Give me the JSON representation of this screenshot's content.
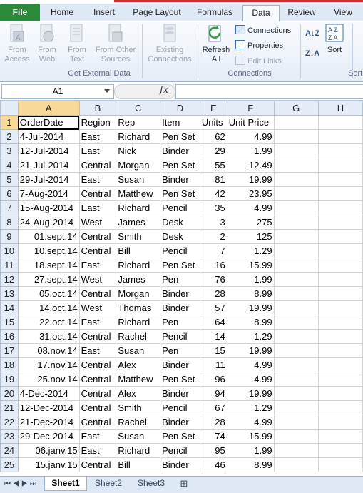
{
  "ribbon_tabs": [
    "File",
    "Home",
    "Insert",
    "Page Layout",
    "Formulas",
    "Data",
    "Review",
    "View"
  ],
  "active_tab": "Data",
  "ribbon": {
    "get_external": {
      "from_access": "From\nAccess",
      "from_web": "From\nWeb",
      "from_text": "From\nText",
      "from_other": "From Other\nSources",
      "existing": "Existing\nConnections",
      "group_label": "Get External Data"
    },
    "connections": {
      "refresh_all": "Refresh\nAll",
      "connections": "Connections",
      "properties": "Properties",
      "edit_links": "Edit Links",
      "group_label": "Connections"
    },
    "sort": {
      "sort_label": "Sort",
      "group_label": "Sort"
    }
  },
  "formula_bar": {
    "name_box": "A1",
    "fx": "fx",
    "value": ""
  },
  "columns": [
    "A",
    "B",
    "C",
    "D",
    "E",
    "F",
    "G",
    "H"
  ],
  "rows": [
    [
      "OrderDate",
      "Region",
      "Rep",
      "Item",
      "Units",
      "Unit Price"
    ],
    [
      "4-Jul-2014",
      "East",
      "Richard",
      "Pen Set",
      "62",
      "4.99"
    ],
    [
      "12-Jul-2014",
      "East",
      "Nick",
      "Binder",
      "29",
      "1.99"
    ],
    [
      "21-Jul-2014",
      "Central",
      "Morgan",
      "Pen Set",
      "55",
      "12.49"
    ],
    [
      "29-Jul-2014",
      "East",
      "Susan",
      "Binder",
      "81",
      "19.99"
    ],
    [
      "7-Aug-2014",
      "Central",
      "Matthew",
      "Pen Set",
      "42",
      "23.95"
    ],
    [
      "15-Aug-2014",
      "East",
      "Richard",
      "Pencil",
      "35",
      "4.99"
    ],
    [
      "24-Aug-2014",
      "West",
      "James",
      "Desk",
      "3",
      "275"
    ],
    [
      "01.sept.14",
      "Central",
      "Smith",
      "Desk",
      "2",
      "125"
    ],
    [
      "10.sept.14",
      "Central",
      "Bill",
      "Pencil",
      "7",
      "1.29"
    ],
    [
      "18.sept.14",
      "East",
      "Richard",
      "Pen Set",
      "16",
      "15.99"
    ],
    [
      "27.sept.14",
      "West",
      "James",
      "Pen",
      "76",
      "1.99"
    ],
    [
      "05.oct.14",
      "Central",
      "Morgan",
      "Binder",
      "28",
      "8.99"
    ],
    [
      "14.oct.14",
      "West",
      "Thomas",
      "Binder",
      "57",
      "19.99"
    ],
    [
      "22.oct.14",
      "East",
      "Richard",
      "Pen",
      "64",
      "8.99"
    ],
    [
      "31.oct.14",
      "Central",
      "Rachel",
      "Pencil",
      "14",
      "1.29"
    ],
    [
      "08.nov.14",
      "East",
      "Susan",
      "Pen",
      "15",
      "19.99"
    ],
    [
      "17.nov.14",
      "Central",
      "Alex",
      "Binder",
      "11",
      "4.99"
    ],
    [
      "25.nov.14",
      "Central",
      "Matthew",
      "Pen Set",
      "96",
      "4.99"
    ],
    [
      "4-Dec-2014",
      "Central",
      "Alex",
      "Binder",
      "94",
      "19.99"
    ],
    [
      "12-Dec-2014",
      "Central",
      "Smith",
      "Pencil",
      "67",
      "1.29"
    ],
    [
      "21-Dec-2014",
      "Central",
      "Rachel",
      "Binder",
      "28",
      "4.99"
    ],
    [
      "29-Dec-2014",
      "East",
      "Susan",
      "Pen Set",
      "74",
      "15.99"
    ],
    [
      "06.janv.15",
      "East",
      "Richard",
      "Pencil",
      "95",
      "1.99"
    ],
    [
      "15.janv.15",
      "Central",
      "Bill",
      "Binder",
      "46",
      "8.99"
    ]
  ],
  "right_aligned_a": [
    9,
    10,
    11,
    12,
    13,
    14,
    15,
    16,
    17,
    18,
    19,
    24,
    25
  ],
  "sheets": [
    "Sheet1",
    "Sheet2",
    "Sheet3"
  ],
  "active_sheet": "Sheet1",
  "colors": {
    "file_tab": "#2a8a3a",
    "header_selected": "#f9d99a",
    "header_bg": "#e4ecf7"
  }
}
